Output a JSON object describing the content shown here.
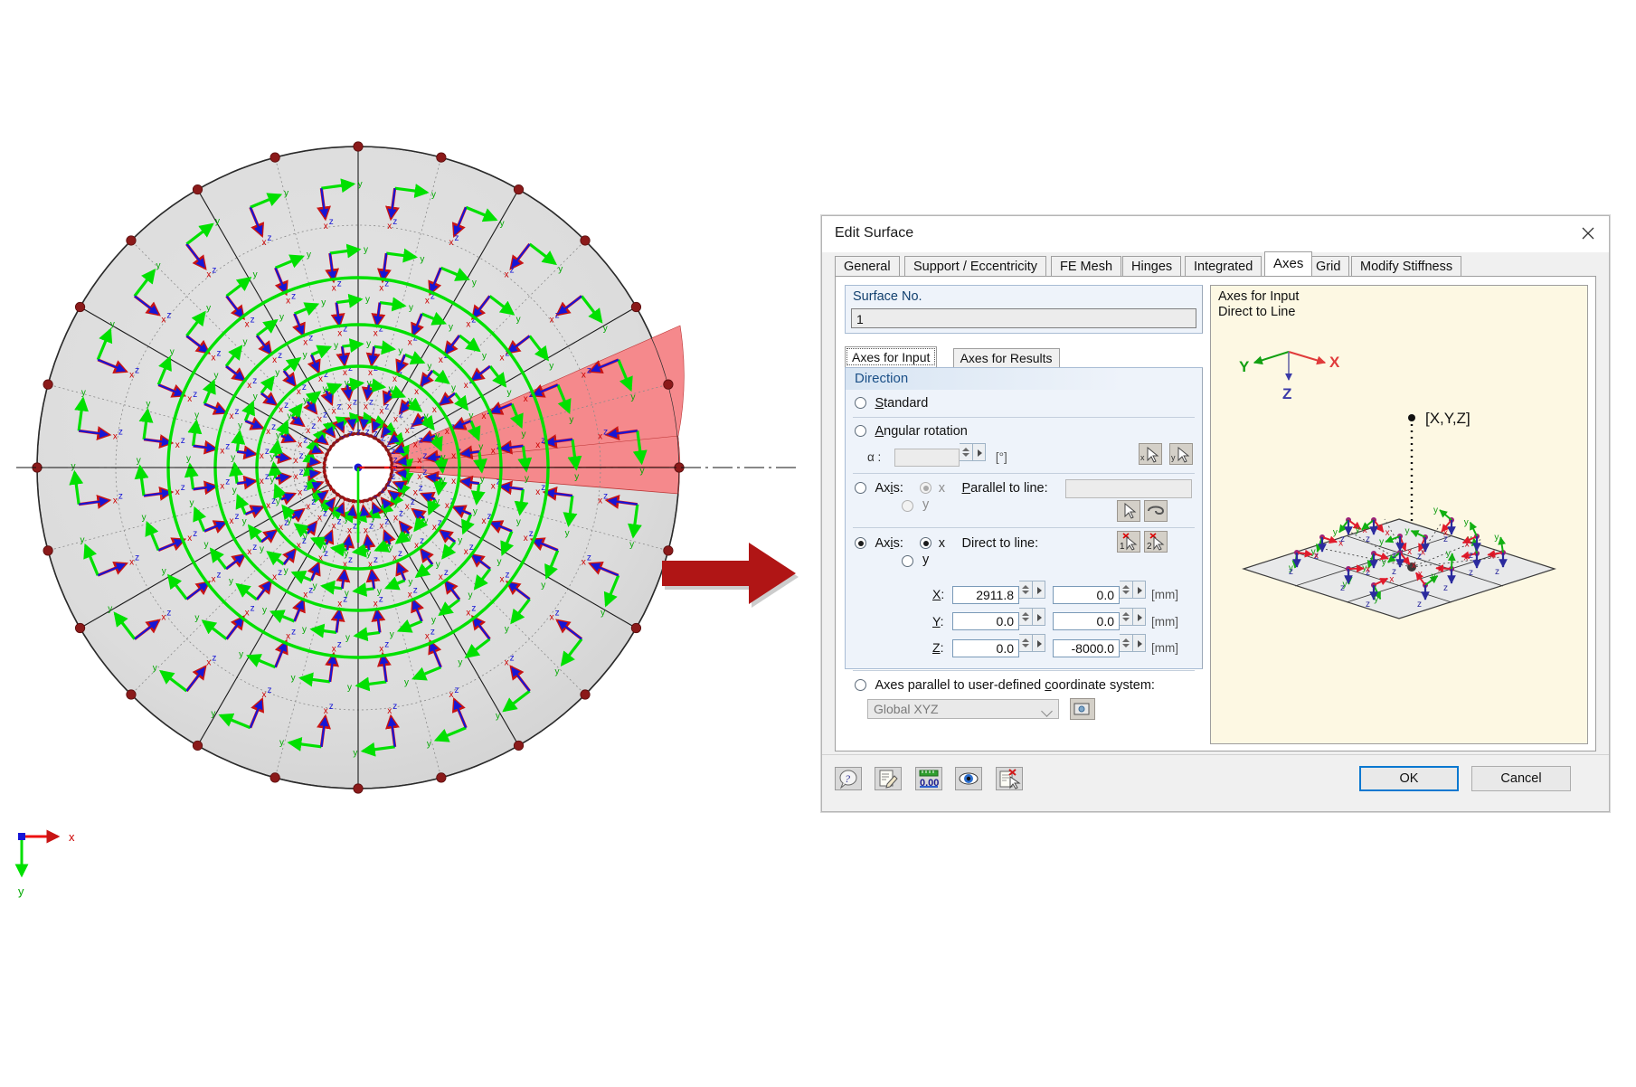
{
  "viewport": {
    "name": "structural-model-view",
    "global_axes": {
      "x_label": "x",
      "y_label": "y"
    },
    "model": {
      "type": "circular-plate-radial-mesh",
      "selected_sector_color": "#f5898c",
      "surface_color": "#dcdcdc",
      "node_color": "#8b1a1a",
      "axis_x_color": "#ee1111",
      "axis_y_color": "#00e000",
      "axis_z_color": "#1616d6",
      "local_axis_labels": {
        "x": "x",
        "y": "y",
        "z": "z"
      }
    },
    "annotation_arrow": {
      "name": "callout-arrow",
      "color": "#b01515",
      "direction": "right"
    }
  },
  "dialog": {
    "title": "Edit Surface",
    "close_label": "✕",
    "tabs": [
      {
        "label": "General",
        "active": false
      },
      {
        "label": "Support / Eccentricity",
        "active": false
      },
      {
        "label": "FE Mesh",
        "active": false
      },
      {
        "label": "Hinges",
        "active": false
      },
      {
        "label": "Integrated",
        "active": false
      },
      {
        "label": "Axes",
        "active": true
      },
      {
        "label": "Grid",
        "active": false
      },
      {
        "label": "Modify Stiffness",
        "active": false
      }
    ],
    "surface_no": {
      "label": "Surface No.",
      "value": "1"
    },
    "inner_tabs": [
      {
        "label": "Axes for Input",
        "active": true
      },
      {
        "label": "Axes for Results",
        "active": false
      }
    ],
    "direction": {
      "title": "Direction",
      "options": {
        "standard": {
          "label": "Standard",
          "selected": false
        },
        "angular_rotation": {
          "label": "Angular rotation",
          "selected": false,
          "alpha_label": "α :",
          "alpha_value": "",
          "alpha_unit": "[°]",
          "buttons": [
            "pick-rotation-x-icon",
            "pick-rotation-y-icon"
          ]
        },
        "axis_parallel": {
          "label": "Axis:",
          "selected": false,
          "axis_x": {
            "label": "x",
            "selected": true
          },
          "axis_y": {
            "label": "y",
            "selected": false
          },
          "field_label": "Parallel to line:",
          "field_value": "",
          "buttons": [
            "pick-line-icon",
            "select-line-icon"
          ]
        },
        "axis_direct": {
          "label": "Axis:",
          "selected": true,
          "axis_x": {
            "label": "x",
            "selected": true
          },
          "axis_y": {
            "label": "y",
            "selected": false
          },
          "field_label": "Direct to line:",
          "buttons": [
            "pick-point-1-icon",
            "pick-point-2-icon"
          ],
          "coordinates": [
            {
              "label": "X:",
              "value1": "2911.8",
              "value2": "0.0",
              "unit": "[mm]"
            },
            {
              "label": "Y:",
              "value1": "0.0",
              "value2": "0.0",
              "unit": "[mm]"
            },
            {
              "label": "Z:",
              "value1": "0.0",
              "value2": "-8000.0",
              "unit": "[mm]"
            }
          ]
        },
        "user_coordinate_system": {
          "label": "Axes parallel to user-defined coordinate system:",
          "selected": false,
          "combo_value": "Global XYZ",
          "button": "edit-coordinate-system-icon"
        }
      }
    },
    "preview": {
      "title": "Axes for Input\nDirect to Line",
      "background": "#fdf8e3",
      "global_axes": {
        "x": "X",
        "y": "Y",
        "z": "Z"
      },
      "point_label": "[X,Y,Z]",
      "local_axes": {
        "x": "x",
        "y": "y",
        "z": "z"
      }
    },
    "footer": {
      "toolbar": [
        "help-icon",
        "comment-icon",
        "units-icon",
        "view-mode-icon",
        "select-objects-icon"
      ],
      "ok_label": "OK",
      "cancel_label": "Cancel"
    }
  }
}
